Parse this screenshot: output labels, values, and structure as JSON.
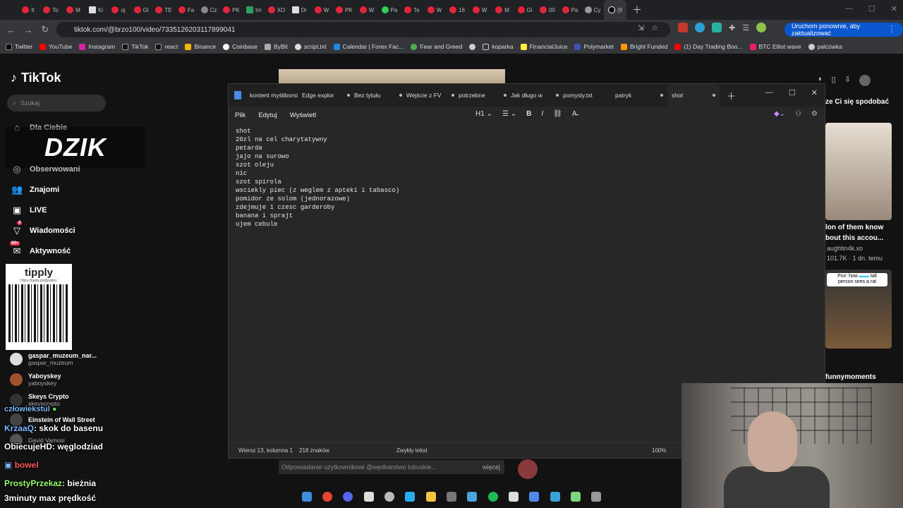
{
  "browser": {
    "tab_labels": [
      "It",
      "To",
      "M",
      "Ki",
      "oj",
      "Gl",
      "TE",
      "Fa",
      "Cz",
      "PK",
      "Im",
      "XO",
      "Di",
      "W",
      "PK",
      "W",
      "Pa",
      "Te",
      "W",
      "16",
      "W",
      "M",
      "Gi",
      "00",
      "Pa",
      "Cy",
      "(9"
    ],
    "url": "tiktok.com/@brzo100/video/7335126203117899041",
    "update_button": "Uruchom ponownie, aby zaktualizować",
    "bookmarks": [
      "Twitter",
      "YouTube",
      "Instagram",
      "TikTok",
      "react",
      "Binance",
      "Coinbase",
      "ByBit",
      "script.txt",
      "Calendar | Forex Fac...",
      "Fear and Greed",
      "koparka",
      "FinancialJuice",
      "Polymarket",
      "Bright Funded",
      "(1) Day Trading Boo...",
      "BTC Elliot wave",
      "palcówka"
    ]
  },
  "tiktok": {
    "logo": "TikTok",
    "search_placeholder": "Szukaj",
    "overlay_brand": "DZIK",
    "nav": {
      "for_you": "Dla Ciebie",
      "following": "Obserwowani",
      "friends": "Znajomi",
      "live": "LIVE",
      "messages": "Wiadomości",
      "messages_badge": "4",
      "activity": "Aktywność",
      "activity_badge": "99+"
    },
    "qr": {
      "title": "tipply",
      "url": "https://tipply.pl/@patirio"
    },
    "following_accounts": [
      {
        "name": "gaspar_muzeum_nar...",
        "handle": "gaspar_muzeum"
      },
      {
        "name": "Yaboyskey",
        "handle": "yaboyskey"
      },
      {
        "name": "Skeys Crypto",
        "handle": "skeyscrypto"
      },
      {
        "name": "Einstein of Wall Street",
        "handle": ""
      },
      {
        "name": "David Vamosi",
        "handle": ""
      }
    ],
    "right_panel": {
      "header": "ze Ci się spodobać",
      "video_title_line1": "lon of them know",
      "video_title_line2": "bout this accou...",
      "author": "aughtin4k.xo",
      "stats": "101.7K · 1 dn. temu",
      "caption_line1": "Pov: how",
      "caption_line2": "tall",
      "caption_line3": "person sees a rat",
      "bottom_tag": "funnymoments"
    },
    "reply_prompt": "Odpowiadanie użytkownikowi @wędkarstwo lubuskie...",
    "reply_more": "więcej"
  },
  "chat": [
    {
      "user": "człowiekstul",
      "msg": ""
    },
    {
      "user": "KrzaaQ",
      "msg": ": skok do basenu"
    },
    {
      "user": "ObiecujeHD",
      "msg": ": węglodziad"
    },
    {
      "user": "bowel",
      "msg": ""
    },
    {
      "user": "ProstyPrzekaz",
      "msg": ": bieżnia"
    },
    {
      "user": "",
      "msg": "3minuty max prędkość"
    }
  ],
  "notepad": {
    "tabs": [
      "kontent myśliborsi",
      "Edge explor",
      "Bez tytułu",
      "Wejście z FV",
      "potrzebne",
      "Jak długo w",
      "pomysly.txt",
      "patryk",
      "shot"
    ],
    "menu": {
      "file": "Plik",
      "edit": "Edytuj",
      "view": "Wyświetl"
    },
    "heading_label": "H1",
    "lines": [
      "shot",
      "20zl na cel charytatywny",
      "petarda",
      "jajo na surowo",
      "szot oleju",
      "nic",
      "szot spirola",
      "wsciekly piec (z weglem z apteki i tabasco)",
      "pomidor ze solom (jednorazowe)",
      "zdejmuje 1 czesc garderoby",
      "banana i sprajt",
      "ujem cebule"
    ],
    "status": {
      "position": "Wiersz 13, kolumna 1",
      "chars": "218 znaków",
      "mode": "Zwykły tekst",
      "zoom": "100%"
    }
  }
}
